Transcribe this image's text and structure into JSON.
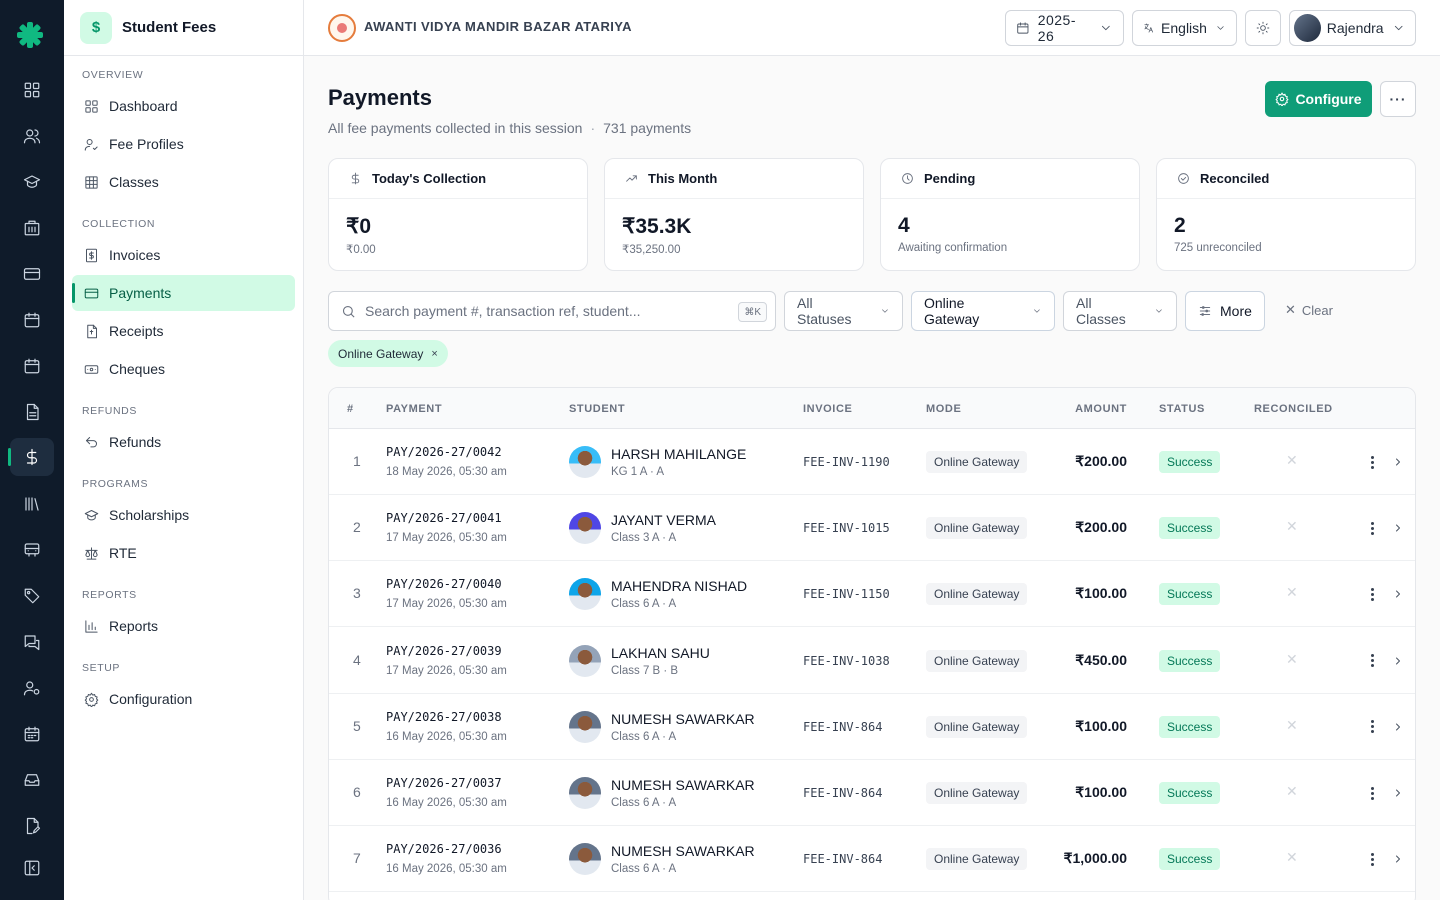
{
  "app": {
    "section_title": "Student Fees",
    "section_icon": "$",
    "school_name": "AWANTI VIDYA MANDIR BAZAR ATARIYA"
  },
  "topbar": {
    "session": "2025-26",
    "language": "English",
    "user_name": "Rajendra"
  },
  "rail": {
    "icons": [
      "dashboard-icon",
      "users-icon",
      "graduation-cap-icon",
      "building-icon",
      "card-icon",
      "calendar-icon",
      "calendar-icon",
      "document-icon",
      "dollar-icon",
      "library-icon",
      "bus-icon",
      "tag-icon",
      "chat-icon",
      "user-settings-icon",
      "calendar-grid-icon",
      "inbox-icon",
      "file-edit-icon",
      "collapse-icon"
    ],
    "active_index": 8,
    "accent": "#10b981"
  },
  "sidebar": {
    "sections": [
      {
        "label": "OVERVIEW",
        "items": [
          {
            "label": "Dashboard",
            "icon": "grid-icon"
          },
          {
            "label": "Fee Profiles",
            "icon": "user-check-icon"
          },
          {
            "label": "Classes",
            "icon": "table-icon"
          }
        ]
      },
      {
        "label": "COLLECTION",
        "items": [
          {
            "label": "Invoices",
            "icon": "invoice-icon"
          },
          {
            "label": "Payments",
            "icon": "card-icon",
            "active": true
          },
          {
            "label": "Receipts",
            "icon": "receipt-icon"
          },
          {
            "label": "Cheques",
            "icon": "cheque-icon"
          }
        ]
      },
      {
        "label": "REFUNDS",
        "items": [
          {
            "label": "Refunds",
            "icon": "undo-icon"
          }
        ]
      },
      {
        "label": "PROGRAMS",
        "items": [
          {
            "label": "Scholarships",
            "icon": "graduation-cap-icon"
          },
          {
            "label": "RTE",
            "icon": "scale-icon"
          }
        ]
      },
      {
        "label": "REPORTS",
        "items": [
          {
            "label": "Reports",
            "icon": "bar-chart-icon"
          }
        ]
      },
      {
        "label": "SETUP",
        "items": [
          {
            "label": "Configuration",
            "icon": "gear-icon"
          }
        ]
      }
    ]
  },
  "page": {
    "title": "Payments",
    "subtitle": "All fee payments collected in this session",
    "dot": "·",
    "count": "731 payments",
    "configure_label": "Configure",
    "more_label": "···"
  },
  "stats": [
    {
      "title": "Today's Collection",
      "icon": "dollar-icon",
      "value": "₹0",
      "sub": "₹0.00"
    },
    {
      "title": "This Month",
      "icon": "trending-up-icon",
      "value": "₹35.3K",
      "sub": "₹35,250.00"
    },
    {
      "title": "Pending",
      "icon": "clock-icon",
      "value": "4",
      "sub": "Awaiting confirmation"
    },
    {
      "title": "Reconciled",
      "icon": "check-circle-icon",
      "value": "2",
      "sub": "725 unreconciled"
    }
  ],
  "filters": {
    "search_placeholder": "Search payment #, transaction ref, student...",
    "shortcut": "⌘K",
    "status": "All Statuses",
    "mode": "Online Gateway",
    "classes": "All Classes",
    "more": "More",
    "clear": "Clear",
    "active_chip": "Online Gateway",
    "chip_remove": "×"
  },
  "table": {
    "columns": [
      "#",
      "PAYMENT",
      "STUDENT",
      "INVOICE",
      "MODE",
      "AMOUNT",
      "STATUS",
      "RECONCILED"
    ],
    "rows": [
      {
        "num": "1",
        "payment": "PAY/2026-27/0042",
        "date": "18 May 2026, 05:30 am",
        "student": "HARSH MAHILANGE",
        "class": "KG 1 A · A",
        "invoice": "FEE-INV-1190",
        "mode": "Online Gateway",
        "amount": "₹200.00",
        "status": "Success",
        "reconciled": "✕"
      },
      {
        "num": "2",
        "payment": "PAY/2026-27/0041",
        "date": "17 May 2026, 05:30 am",
        "student": "JAYANT VERMA",
        "class": "Class 3 A · A",
        "invoice": "FEE-INV-1015",
        "mode": "Online Gateway",
        "amount": "₹200.00",
        "status": "Success",
        "reconciled": "✕"
      },
      {
        "num": "3",
        "payment": "PAY/2026-27/0040",
        "date": "17 May 2026, 05:30 am",
        "student": "MAHENDRA NISHAD",
        "class": "Class 6 A · A",
        "invoice": "FEE-INV-1150",
        "mode": "Online Gateway",
        "amount": "₹100.00",
        "status": "Success",
        "reconciled": "✕"
      },
      {
        "num": "4",
        "payment": "PAY/2026-27/0039",
        "date": "17 May 2026, 05:30 am",
        "student": "LAKHAN SAHU",
        "class": "Class 7 B · B",
        "invoice": "FEE-INV-1038",
        "mode": "Online Gateway",
        "amount": "₹450.00",
        "status": "Success",
        "reconciled": "✕"
      },
      {
        "num": "5",
        "payment": "PAY/2026-27/0038",
        "date": "16 May 2026, 05:30 am",
        "student": "NUMESH SAWARKAR",
        "class": "Class 6 A · A",
        "invoice": "FEE-INV-864",
        "mode": "Online Gateway",
        "amount": "₹100.00",
        "status": "Success",
        "reconciled": "✕"
      },
      {
        "num": "6",
        "payment": "PAY/2026-27/0037",
        "date": "16 May 2026, 05:30 am",
        "student": "NUMESH SAWARKAR",
        "class": "Class 6 A · A",
        "invoice": "FEE-INV-864",
        "mode": "Online Gateway",
        "amount": "₹100.00",
        "status": "Success",
        "reconciled": "✕"
      },
      {
        "num": "7",
        "payment": "PAY/2026-27/0036",
        "date": "16 May 2026, 05:30 am",
        "student": "NUMESH SAWARKAR",
        "class": "Class 6 A · A",
        "invoice": "FEE-INV-864",
        "mode": "Online Gateway",
        "amount": "₹1,000.00",
        "status": "Success",
        "reconciled": "✕"
      }
    ]
  },
  "colors": {
    "primary": "#0f9d78",
    "rail_bg": "#0f1b2a",
    "active_bg": "#d1fae5",
    "success_text": "#047857"
  }
}
